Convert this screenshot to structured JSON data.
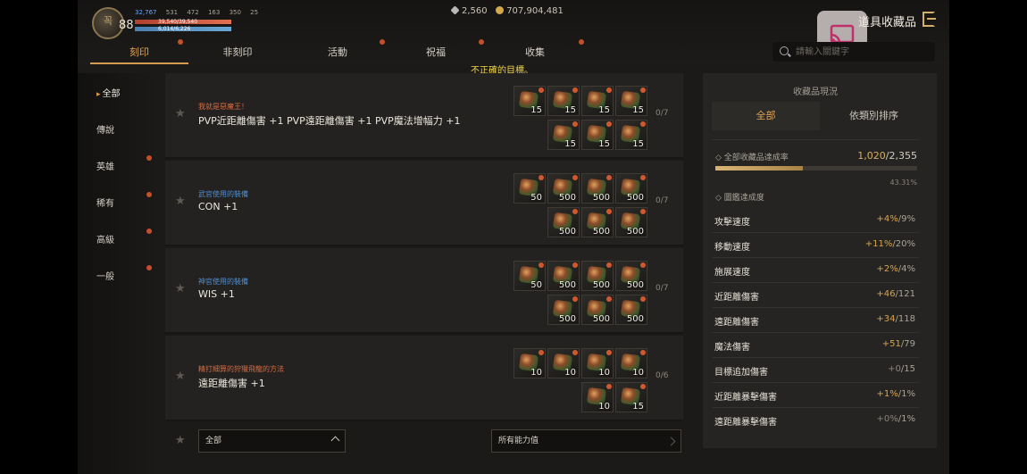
{
  "player": {
    "level": "88",
    "emblem_text": "꼭",
    "stats": {
      "attack": "32,767",
      "s2": "531",
      "s3": "472",
      "s4": "163",
      "s5": "350",
      "s6": "25"
    },
    "hp": "39,540/39,540",
    "mp": "6,014/6,226"
  },
  "currency": {
    "diamonds": "2,560",
    "gold": "707,904,481"
  },
  "header": {
    "title": "道具收藏品"
  },
  "tabs": [
    {
      "label": "刻印",
      "active": true
    },
    {
      "label": "非刻印"
    },
    {
      "label": "活動"
    },
    {
      "label": "祝福"
    },
    {
      "label": "收集"
    }
  ],
  "search": {
    "placeholder": "請輸入關鍵字"
  },
  "notice": "不正確的目標。",
  "sidebar": [
    {
      "label": "全部",
      "active": true
    },
    {
      "label": "傳說"
    },
    {
      "label": "英雄"
    },
    {
      "label": "稀有"
    },
    {
      "label": "高級"
    },
    {
      "label": "一般"
    }
  ],
  "collections": [
    {
      "category": "我就是惡魔王！",
      "category_color": "#d76a42",
      "effect": "PVP近距離傷害 +1 PVP遠距離傷害 +1 PVP魔法增幅力 +1",
      "progress": "0/7",
      "slots_top": [
        "15",
        "15",
        "15",
        "15"
      ],
      "slots_bottom": [
        "15",
        "15",
        "15"
      ]
    },
    {
      "category": "武官使用的裝備",
      "category_color": "#4c8fd8",
      "effect": "CON +1",
      "progress": "0/7",
      "slots_top": [
        "50",
        "500",
        "500",
        "500"
      ],
      "slots_bottom": [
        "500",
        "500",
        "500"
      ]
    },
    {
      "category": "神官使用的裝備",
      "category_color": "#4c8fd8",
      "effect": "WIS +1",
      "progress": "0/7",
      "slots_top": [
        "50",
        "500",
        "500",
        "500"
      ],
      "slots_bottom": [
        "500",
        "500",
        "500"
      ]
    },
    {
      "category": "精打細算的狩獵飛龍的方法",
      "category_color": "#d76a42",
      "effect": "遠距離傷害 +1",
      "progress": "0/6",
      "slots_top": [
        "10",
        "10",
        "10",
        "10"
      ],
      "slots_bottom": [
        "10",
        "15"
      ]
    }
  ],
  "filters": {
    "grade": "全部",
    "ability": "所有能力值"
  },
  "panel": {
    "title": "收藏品現況",
    "tabs": [
      {
        "label": "全部",
        "active": true
      },
      {
        "label": "依類別排序"
      }
    ],
    "achievement": {
      "label": "全部收藏品達成率",
      "current": "1,020",
      "total": "2,355",
      "percent": "43.31%",
      "fraction": 0.4331
    },
    "stats_label": "圖鑑達成度",
    "stats": [
      {
        "name": "攻擊速度",
        "current": "+4%",
        "max": "9%"
      },
      {
        "name": "移動速度",
        "current": "+11%",
        "max": "20%"
      },
      {
        "name": "施展速度",
        "current": "+2%",
        "max": "4%"
      },
      {
        "name": "近距離傷害",
        "current": "+46",
        "max": "121"
      },
      {
        "name": "遠距離傷害",
        "current": "+34",
        "max": "118"
      },
      {
        "name": "魔法傷害",
        "current": "+51",
        "max": "79"
      },
      {
        "name": "目標追加傷害",
        "current": "+0",
        "max": "15",
        "zero": true
      },
      {
        "name": "近距離暴擊傷害",
        "current": "+1%",
        "max": "1%"
      },
      {
        "name": "遠距離暴擊傷害",
        "current": "+0%",
        "max": "1%",
        "zero": true
      }
    ]
  }
}
